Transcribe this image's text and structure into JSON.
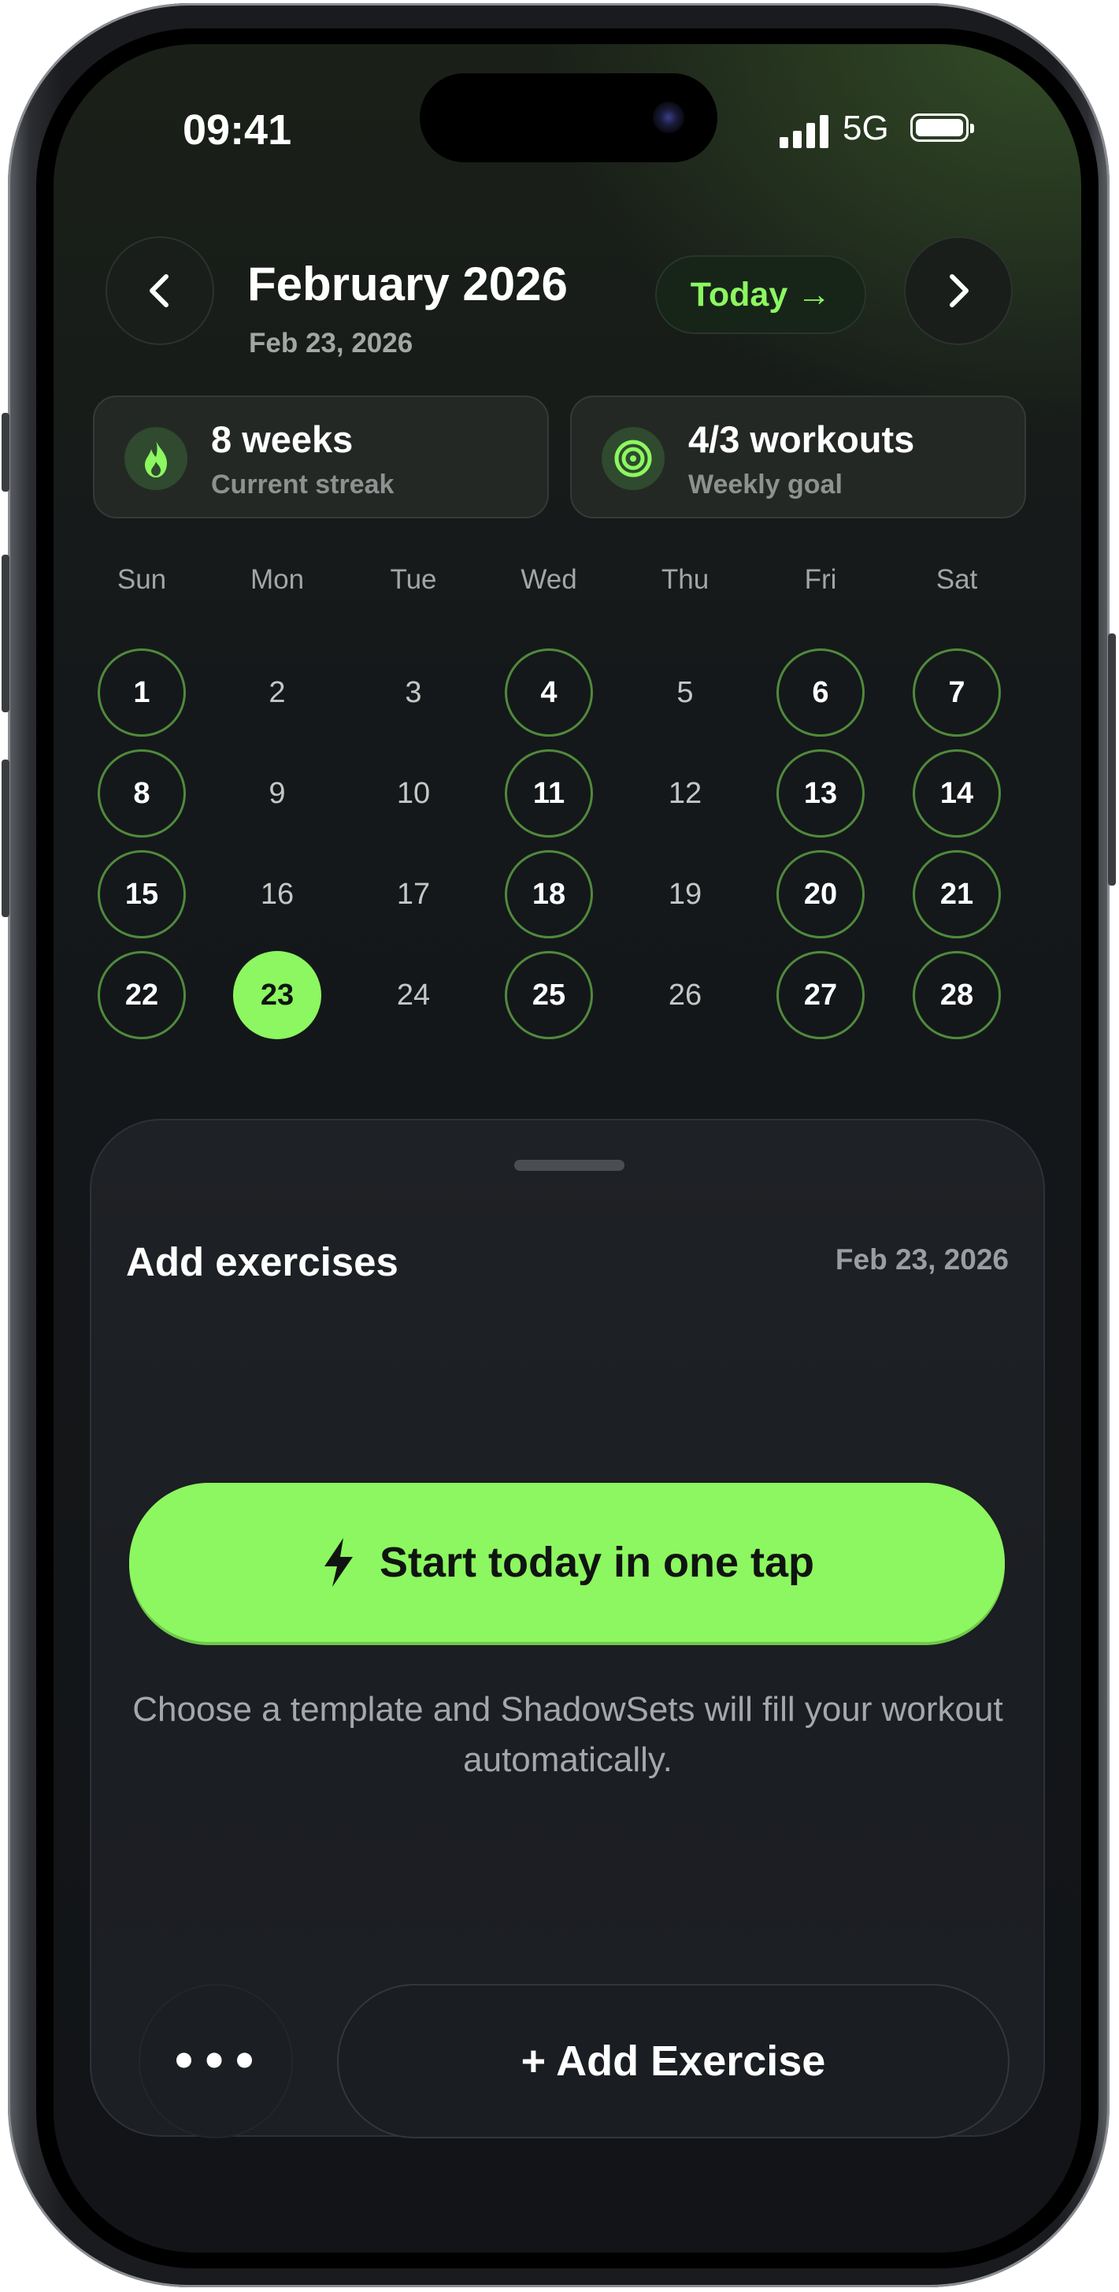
{
  "status_bar": {
    "time": "09:41",
    "network": "5G"
  },
  "header": {
    "month_title": "February 2026",
    "selected_date": "Feb 23, 2026",
    "today_label": "Today →",
    "prev_icon": "chevron-left-icon",
    "next_icon": "chevron-right-icon"
  },
  "stats": [
    {
      "value": "8 weeks",
      "label": "Current streak",
      "icon": "flame-icon"
    },
    {
      "value": "4/3 workouts",
      "label": "Weekly goal",
      "icon": "target-icon"
    }
  ],
  "calendar": {
    "weekdays": [
      "Sun",
      "Mon",
      "Tue",
      "Wed",
      "Thu",
      "Fri",
      "Sat"
    ],
    "days": [
      {
        "label": "1",
        "state": "workout"
      },
      {
        "label": "2",
        "state": "plain"
      },
      {
        "label": "3",
        "state": "plain"
      },
      {
        "label": "4",
        "state": "workout"
      },
      {
        "label": "5",
        "state": "plain"
      },
      {
        "label": "6",
        "state": "workout"
      },
      {
        "label": "7",
        "state": "workout"
      },
      {
        "label": "8",
        "state": "workout"
      },
      {
        "label": "9",
        "state": "plain"
      },
      {
        "label": "10",
        "state": "plain"
      },
      {
        "label": "11",
        "state": "workout"
      },
      {
        "label": "12",
        "state": "plain"
      },
      {
        "label": "13",
        "state": "workout"
      },
      {
        "label": "14",
        "state": "workout"
      },
      {
        "label": "15",
        "state": "workout"
      },
      {
        "label": "16",
        "state": "plain"
      },
      {
        "label": "17",
        "state": "plain"
      },
      {
        "label": "18",
        "state": "workout"
      },
      {
        "label": "19",
        "state": "plain"
      },
      {
        "label": "20",
        "state": "workout"
      },
      {
        "label": "21",
        "state": "workout"
      },
      {
        "label": "22",
        "state": "workout"
      },
      {
        "label": "23",
        "state": "today"
      },
      {
        "label": "24",
        "state": "plain"
      },
      {
        "label": "25",
        "state": "workout"
      },
      {
        "label": "26",
        "state": "plain"
      },
      {
        "label": "27",
        "state": "workout"
      },
      {
        "label": "28",
        "state": "workout"
      }
    ]
  },
  "sheet": {
    "title": "Add exercises",
    "date": "Feb 23, 2026",
    "primary_button": "Start today in one tap",
    "primary_icon": "lightning-icon",
    "helper_text": "Choose a template and ShadowSets will fill your workout automatically.",
    "more_label": "•••",
    "add_button": "+ Add Exercise"
  },
  "colors": {
    "accent": "#8cf760",
    "workout_ring": "#4f8a3c",
    "background": "#121417"
  }
}
